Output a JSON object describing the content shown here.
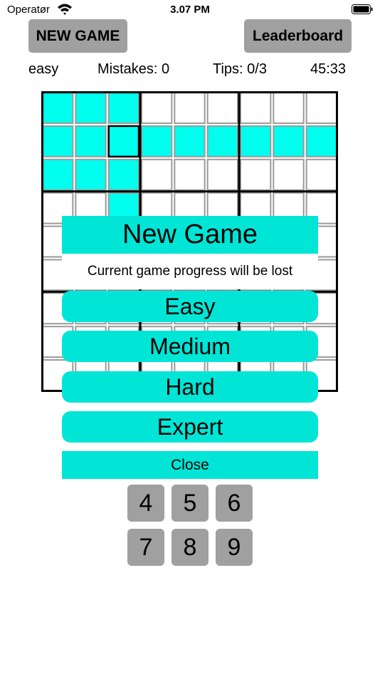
{
  "status_bar": {
    "carrier": "Operatør",
    "time": "3.07 PM"
  },
  "toolbar": {
    "new_game_label": "NEW GAME",
    "leaderboard_label": "Leaderboard"
  },
  "info": {
    "difficulty": "easy",
    "mistakes": "Mistakes: 0",
    "tips": "Tips: 0/3",
    "timer": "45:33"
  },
  "board": {
    "highlight_color": "#00ffee",
    "highlighted_cells": [
      [
        0,
        0
      ],
      [
        0,
        1
      ],
      [
        0,
        2
      ],
      [
        1,
        0
      ],
      [
        1,
        1
      ],
      [
        1,
        2
      ],
      [
        1,
        3
      ],
      [
        1,
        4
      ],
      [
        1,
        5
      ],
      [
        1,
        6
      ],
      [
        1,
        7
      ],
      [
        1,
        8
      ],
      [
        2,
        0
      ],
      [
        2,
        1
      ],
      [
        2,
        2
      ],
      [
        3,
        2
      ]
    ],
    "selected_cell": [
      1,
      2
    ]
  },
  "modal": {
    "title": "New Game",
    "subtitle": "Current game progress will be lost",
    "options": [
      "Easy",
      "Medium",
      "Hard",
      "Expert"
    ],
    "close_label": "Close",
    "accent_color": "#00e5d6"
  },
  "keypad": {
    "keys": [
      "4",
      "5",
      "6",
      "7",
      "8",
      "9"
    ]
  }
}
